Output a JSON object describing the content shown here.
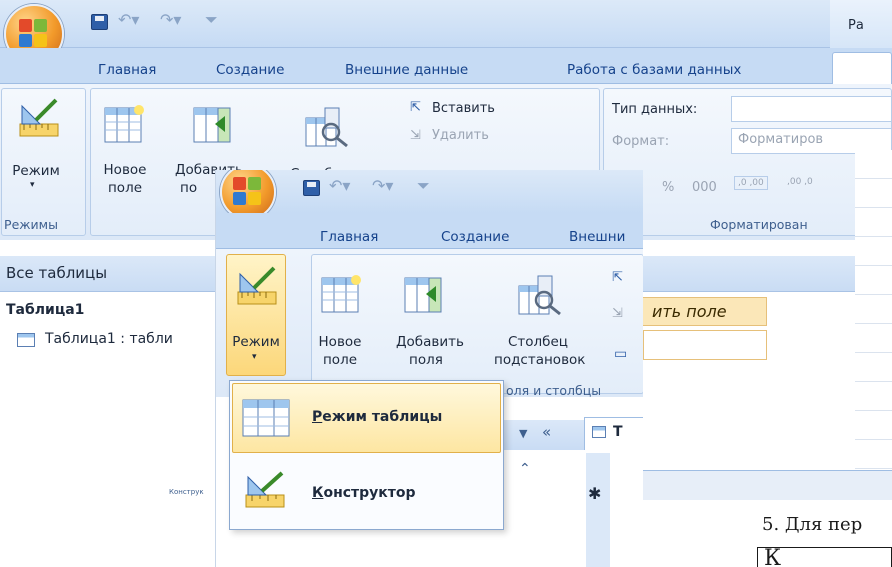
{
  "background_window": {
    "title_fragment": "Ра",
    "tabs": [
      "Главная",
      "Создание",
      "Внешние данные",
      "Работа с базами данных"
    ],
    "ribbon": {
      "mode_button": "Режим",
      "mode_group": "Режимы",
      "new_field": [
        "Новое",
        "поле"
      ],
      "add_field": [
        "Добавить",
        "по"
      ],
      "lookup_column_fragment": "Столбец",
      "insert": "Вставить",
      "delete": "Удалить",
      "data_type_label": "Тип данных:",
      "format_label": "Формат:",
      "format_value": "Форматиров",
      "formatting_group": "Форматирован",
      "percent": "%",
      "thousands": "000",
      "dec_inc": ",0 ,00",
      "dec_dec": ",00 ,0"
    },
    "nav": {
      "header": "Все таблицы",
      "group": "Таблица1",
      "item": "Таблица1 : табли",
      "status_fragment": "Конструк"
    }
  },
  "foreground_window": {
    "tabs": [
      "Главная",
      "Создание",
      "Внешни"
    ],
    "ribbon": {
      "mode_button": "Режим",
      "new_field": [
        "Новое",
        "поле"
      ],
      "add_field": [
        "Добавить",
        "поля"
      ],
      "lookup_column": [
        "Столбец",
        "подстановок"
      ],
      "fields_columns_group": "оля и столбцы"
    },
    "dropdown": {
      "items": [
        {
          "accel": "Р",
          "rest": "ежим таблицы",
          "icon": "datasheet-view-icon"
        },
        {
          "accel": "К",
          "rest": "онструктор",
          "icon": "design-view-icon"
        }
      ]
    },
    "nav_controls": {
      "dropdown_arrow": "▼",
      "collapse": "«",
      "up_arrows": "⌃"
    },
    "table_tab_fragment": "Т",
    "new_row_marker": "✱"
  },
  "right_fragments": {
    "field_caption": "ить поле",
    "doc_text": "5. Для пер",
    "doc_box_fragment": "К"
  },
  "colors": {
    "ribbon_blue": "#c6dbf4",
    "tab_text": "#15428b",
    "office_orange": "#f29a2a",
    "field_highlight": "#fbe7b8"
  }
}
